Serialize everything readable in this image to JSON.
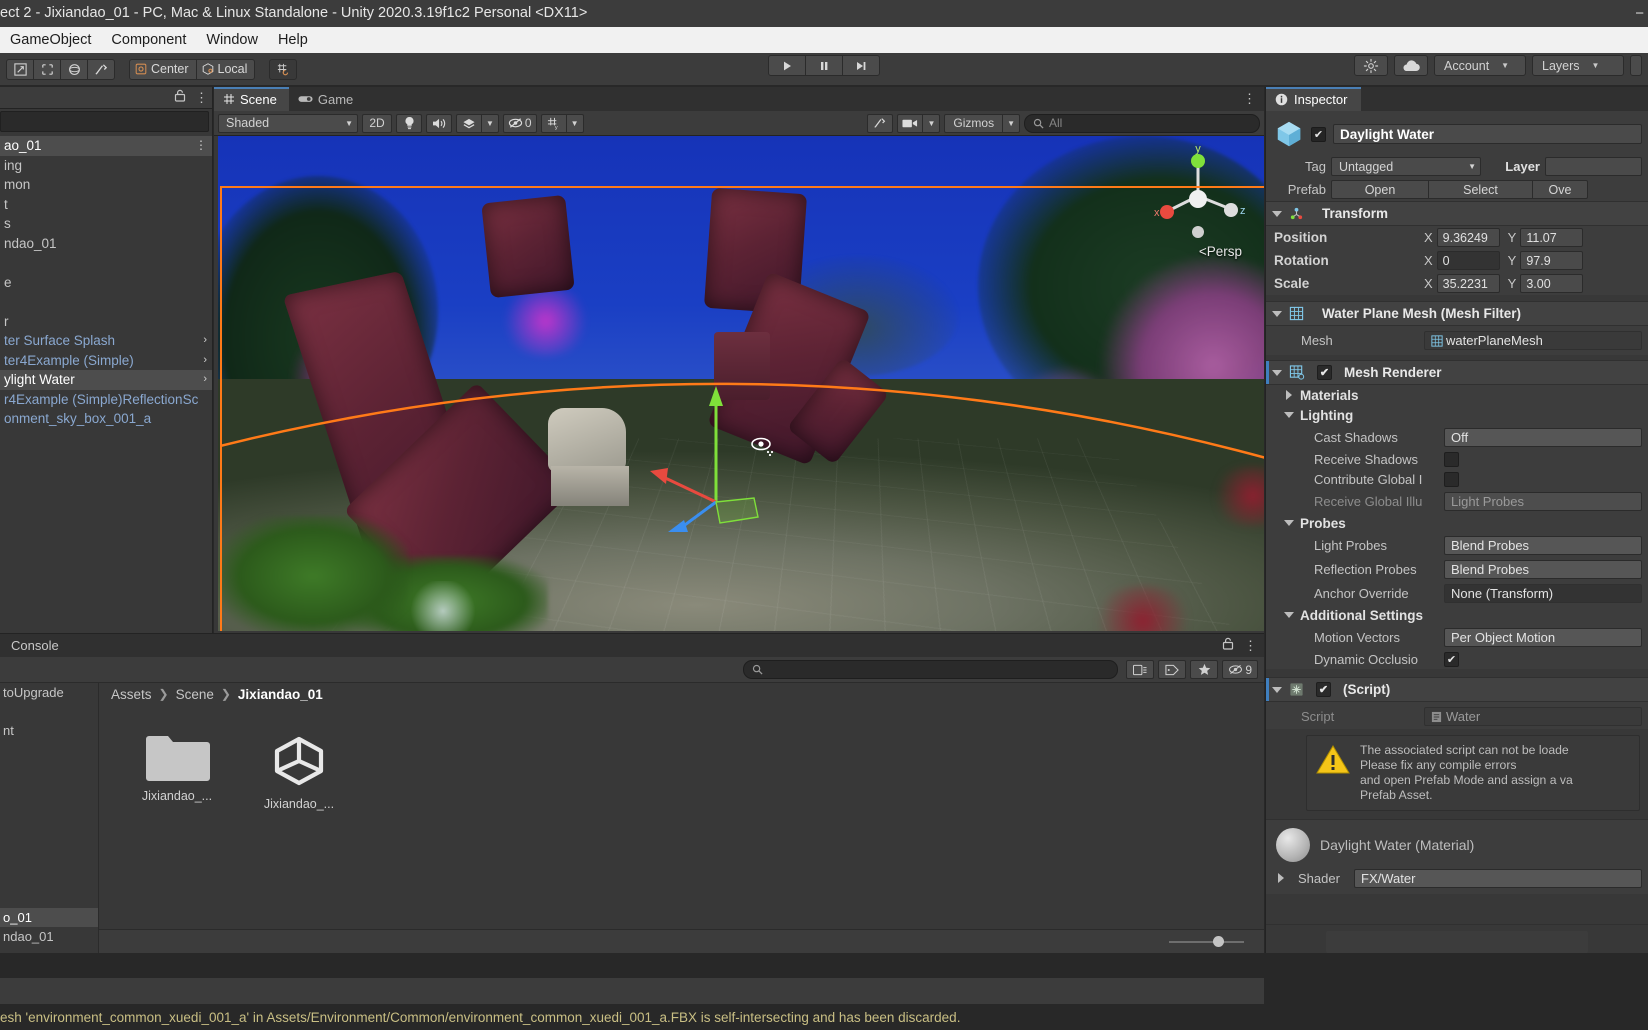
{
  "window": {
    "title": "ect 2 - Jixiandao_01 - PC, Mac & Linux Standalone - Unity 2020.3.19f1c2 Personal <DX11>",
    "minimize": "−",
    "maximize": "□",
    "close": "×"
  },
  "menubar": {
    "items": [
      "GameObject",
      "Component",
      "Window",
      "Help"
    ]
  },
  "toolbar": {
    "transform_tools": [
      "hand-tool",
      "move-tool",
      "rotate-tool",
      "scale-tool",
      "rect-tool",
      "transform-tool"
    ],
    "pivot_mode": "Center",
    "pivot_rotation": "Local",
    "grid_snap": "grid-snap",
    "play": "▶",
    "pause": "❚❚",
    "step": "▶❚",
    "account": "Account",
    "layers": "Layers",
    "collab": "cloud-icon",
    "search_services": "services-icon"
  },
  "hierarchy": {
    "search_placeholder": "",
    "items": [
      {
        "label": "ao_01",
        "selected": true,
        "prefab": false
      },
      {
        "label": "ing",
        "selected": false,
        "prefab": false
      },
      {
        "label": "mon",
        "selected": false,
        "prefab": false
      },
      {
        "label": "t",
        "selected": false,
        "prefab": false
      },
      {
        "label": "s",
        "selected": false,
        "prefab": false
      },
      {
        "label": "ndao_01",
        "selected": false,
        "prefab": false
      },
      {
        "label": "",
        "selected": false,
        "prefab": false
      },
      {
        "label": "e",
        "selected": false,
        "prefab": false
      },
      {
        "label": "",
        "selected": false,
        "prefab": false
      },
      {
        "label": "r",
        "selected": false,
        "prefab": false
      },
      {
        "label": "ter Surface Splash",
        "selected": false,
        "prefab": true
      },
      {
        "label": "ter4Example (Simple)",
        "selected": false,
        "prefab": true
      },
      {
        "label": "ylight Water",
        "selected": true,
        "prefab": false
      },
      {
        "label": "r4Example (Simple)ReflectionSc",
        "selected": false,
        "prefab": true
      },
      {
        "label": "onment_sky_box_001_a",
        "selected": false,
        "prefab": true
      }
    ]
  },
  "scene": {
    "tabs": [
      {
        "label": "Scene",
        "icon": "grid-icon",
        "active": true
      },
      {
        "label": "Game",
        "icon": "gamepad-icon",
        "active": false
      }
    ],
    "draw_mode": "Shaded",
    "toggle_2d": "2D",
    "lighting": "light-icon",
    "audio": "audio-icon",
    "fx": "fx-icon",
    "hidden_count": "0",
    "grid": "grid-visibility-icon",
    "tools": "tools-icon",
    "camera": "camera-icon",
    "gizmos": "Gizmos",
    "search_placeholder": "All",
    "perspective_label": "Persp",
    "gizmo_axes": {
      "x": "x",
      "y": "y",
      "z": "z"
    },
    "selection_color": "#ff7a18"
  },
  "project": {
    "tabs": [
      {
        "label": "Console",
        "active": false
      }
    ],
    "search_placeholder": "",
    "breadcrumb": [
      "Assets",
      "Scene",
      "Jixiandao_01"
    ],
    "assets": [
      {
        "label": "Jixiandao_...",
        "type": "folder"
      },
      {
        "label": "Jixiandao_...",
        "type": "unity-scene"
      }
    ],
    "tree": [
      {
        "label": "toUpgrade",
        "selected": false
      },
      {
        "label": "",
        "selected": false
      },
      {
        "label": "nt",
        "selected": false
      },
      {
        "label": "",
        "selected": false
      },
      {
        "label": "",
        "selected": false
      },
      {
        "label": "",
        "selected": false
      },
      {
        "label": "",
        "selected": false
      },
      {
        "label": "",
        "selected": false
      },
      {
        "label": "",
        "selected": false
      },
      {
        "label": "",
        "selected": false
      },
      {
        "label": "o_01",
        "selected": true
      },
      {
        "label": "ndao_01",
        "selected": false
      }
    ],
    "filter_count": "9"
  },
  "inspector": {
    "tab_label": "Inspector",
    "object_name": "Daylight Water",
    "object_enabled": true,
    "tag_label": "Tag",
    "tag_value": "Untagged",
    "layer_label": "Layer",
    "prefab_label": "Prefab",
    "prefab_buttons": [
      "Open",
      "Select",
      "Ove"
    ],
    "transform": {
      "title": "Transform",
      "rows": [
        {
          "label": "Position",
          "x": "9.36249",
          "y": "11.07"
        },
        {
          "label": "Rotation",
          "x": "0",
          "y": "97.9"
        },
        {
          "label": "Scale",
          "x": "35.2231",
          "y": "3.00"
        }
      ]
    },
    "mesh_filter": {
      "title": "Water Plane Mesh (Mesh Filter)",
      "mesh_label": "Mesh",
      "mesh_value": "waterPlaneMesh"
    },
    "mesh_renderer": {
      "title": "Mesh Renderer",
      "enabled": true,
      "materials_label": "Materials",
      "lighting_label": "Lighting",
      "cast_shadows_label": "Cast Shadows",
      "cast_shadows_value": "Off",
      "receive_shadows_label": "Receive Shadows",
      "receive_shadows_value": false,
      "contribute_gi_label": "Contribute Global I",
      "contribute_gi_value": false,
      "receive_gi_label": "Receive Global Illu",
      "receive_gi_value": "Light Probes",
      "probes_label": "Probes",
      "light_probes_label": "Light Probes",
      "light_probes_value": "Blend Probes",
      "reflection_probes_label": "Reflection Probes",
      "reflection_probes_value": "Blend Probes",
      "anchor_override_label": "Anchor Override",
      "anchor_override_value": "None (Transform)",
      "additional_settings_label": "Additional Settings",
      "motion_vectors_label": "Motion Vectors",
      "motion_vectors_value": "Per Object Motion",
      "dynamic_occlusion_label": "Dynamic Occlusio",
      "dynamic_occlusion_value": true
    },
    "script_component": {
      "title": "(Script)",
      "enabled": true,
      "script_label": "Script",
      "script_value": "Water",
      "warning_lines": [
        "The associated script can not be loade",
        "Please fix any compile errors",
        "and open Prefab Mode and assign a va",
        "Prefab Asset."
      ]
    },
    "material": {
      "title": "Daylight Water (Material)",
      "shader_label": "Shader",
      "shader_value": "FX/Water"
    }
  },
  "statusbar": {
    "message": "esh 'environment_common_xuedi_001_a' in Assets/Environment/Common/environment_common_xuedi_001_a.FBX is self-intersecting and has been discarded."
  }
}
